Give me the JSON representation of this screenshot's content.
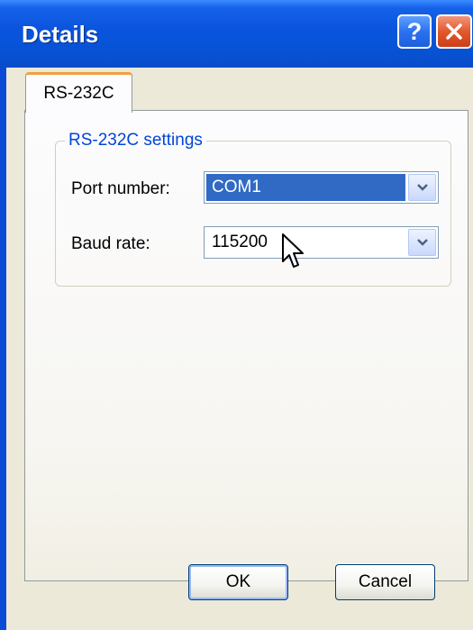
{
  "window": {
    "title": "Details",
    "help_icon": "question-mark-icon",
    "close_icon": "close-x-icon"
  },
  "tabs": [
    {
      "label": "RS-232C",
      "selected": true
    }
  ],
  "group": {
    "legend": "RS-232C settings",
    "fields": {
      "port": {
        "label": "Port number:",
        "value": "COM1"
      },
      "baud": {
        "label": "Baud rate:",
        "value": "115200"
      }
    }
  },
  "buttons": {
    "ok": "OK",
    "cancel": "Cancel"
  },
  "colors": {
    "title_bar": "#0653d6",
    "tab_accent": "#f2a03f",
    "legend_text": "#0046d5",
    "selection": "#316ac5",
    "dialog_face": "#ece9d8"
  },
  "cursor_icon": "arrow-pointer-icon"
}
